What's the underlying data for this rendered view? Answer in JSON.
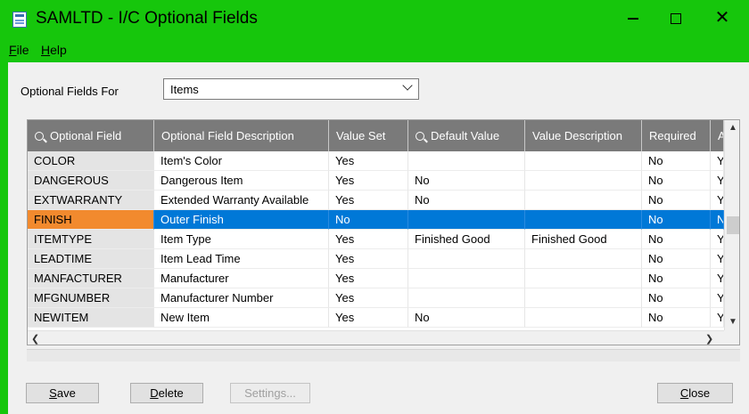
{
  "window": {
    "title": "SAMLTD - I/C Optional Fields",
    "controls": {
      "minimize": "minimize",
      "maximize": "maximize",
      "close": "✕"
    }
  },
  "menu": {
    "file": {
      "accel": "F",
      "rest": "ile"
    },
    "help": {
      "accel": "H",
      "rest": "elp"
    }
  },
  "form": {
    "for_label": "Optional Fields For",
    "for_value": "Items"
  },
  "grid": {
    "columns": [
      {
        "label": "Optional Field",
        "search": true
      },
      {
        "label": "Optional Field Description",
        "search": false
      },
      {
        "label": "Value Set",
        "search": false
      },
      {
        "label": "Default Value",
        "search": true
      },
      {
        "label": "Value Description",
        "search": false
      },
      {
        "label": "Required",
        "search": false
      },
      {
        "label": "A",
        "search": false
      }
    ],
    "rows": [
      [
        "COLOR",
        "Item's Color",
        "Yes",
        "",
        "",
        "No",
        "Y"
      ],
      [
        "DANGEROUS",
        "Dangerous Item",
        "Yes",
        "No",
        "",
        "No",
        "Y"
      ],
      [
        "EXTWARRANTY",
        "Extended Warranty Available",
        "Yes",
        "No",
        "",
        "No",
        "Y"
      ],
      [
        "FINISH",
        "Outer Finish",
        "No",
        "",
        "",
        "No",
        "N"
      ],
      [
        "ITEMTYPE",
        "Item Type",
        "Yes",
        "Finished Good",
        "Finished Good",
        "No",
        "Y"
      ],
      [
        "LEADTIME",
        "Item Lead Time",
        "Yes",
        "",
        "",
        "No",
        "Y"
      ],
      [
        "MANFACTURER",
        "Manufacturer",
        "Yes",
        "",
        "",
        "No",
        "Y"
      ],
      [
        "MFGNUMBER",
        "Manufacturer Number",
        "Yes",
        "",
        "",
        "No",
        "Y"
      ],
      [
        "NEWITEM",
        "New Item",
        "Yes",
        "No",
        "",
        "No",
        "Y"
      ]
    ],
    "selected_row": 3
  },
  "buttons": {
    "save": {
      "accel": "S",
      "rest": "ave"
    },
    "delete": {
      "accel": "D",
      "rest": "elete"
    },
    "settings": "Settings...",
    "close": {
      "accel": "C",
      "rest": "lose"
    }
  },
  "colors": {
    "titlebar": "#16c60c",
    "grid_header": "#7a7a7a",
    "selection": "#0078d7",
    "selected_key": "#f28a2e"
  }
}
